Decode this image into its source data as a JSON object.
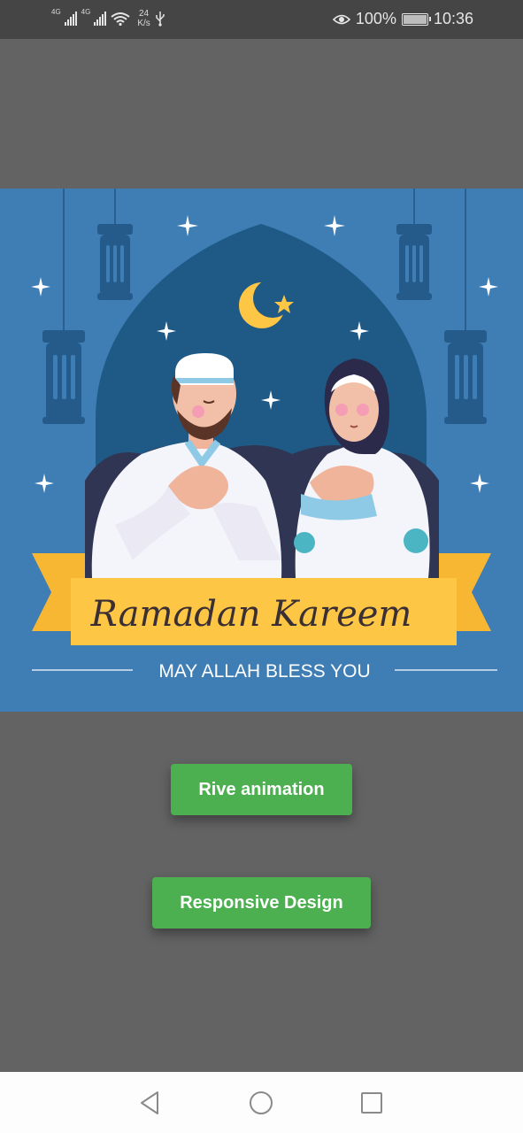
{
  "status_bar": {
    "network_1": "4G",
    "network_2": "4G",
    "speed_value": "24",
    "speed_unit": "K/s",
    "battery_percent": "100%",
    "time": "10:36",
    "icons": [
      "signal-icon",
      "signal-icon",
      "wifi-icon",
      "usb-icon",
      "eye-icon",
      "battery-icon"
    ]
  },
  "banner": {
    "title": "Ramadan Kareem",
    "subtitle": "MAY ALLAH BLESS YOU"
  },
  "buttons": {
    "rive_label": "Rive animation",
    "responsive_label": "Responsive Design",
    "color": "#4caf50"
  },
  "nav_bar": {
    "icons": [
      "back-icon",
      "home-icon",
      "recents-icon"
    ]
  },
  "colors": {
    "background": "#636363",
    "status_bar": "#454545",
    "banner_bg": "#3f7db5",
    "ribbon": "#fdc644"
  }
}
